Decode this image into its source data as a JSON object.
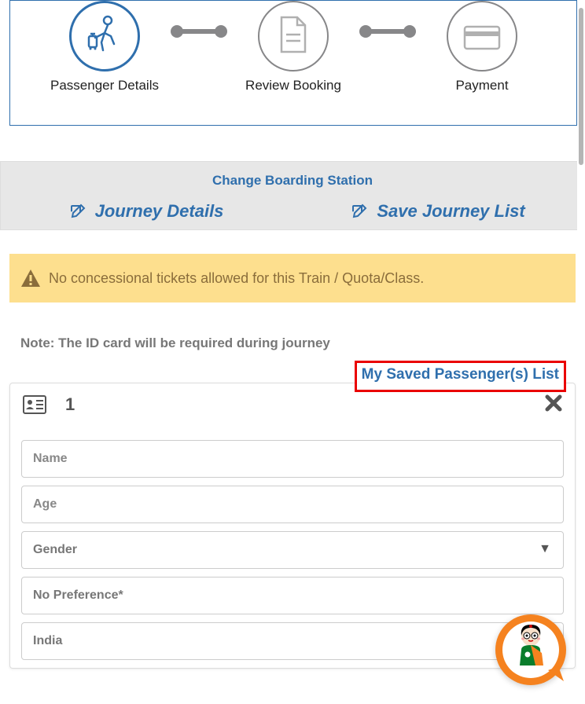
{
  "stepper": {
    "steps": [
      {
        "label": "Passenger Details",
        "icon": "traveler-icon",
        "active": true
      },
      {
        "label": "Review Booking",
        "icon": "document-icon",
        "active": false
      },
      {
        "label": "Payment",
        "icon": "card-icon",
        "active": false
      }
    ]
  },
  "actions": {
    "change_boarding": "Change Boarding Station",
    "journey_details": "Journey Details",
    "save_journey_list": "Save Journey List"
  },
  "warning": {
    "text": "No concessional tickets allowed for this Train / Quota/Class."
  },
  "note": "Note: The ID card will be required during journey",
  "saved_passenger_link": "My Saved Passenger(s) List",
  "passenger": {
    "number": "1",
    "fields": {
      "name_placeholder": "Name",
      "age_placeholder": "Age",
      "gender_placeholder": "Gender",
      "preference_value": "No Preference*",
      "nationality_value": "India"
    }
  },
  "colors": {
    "primary": "#2f6fad",
    "warning_bg": "#fddf8e",
    "warning_text": "#8a6d3b",
    "highlight_border": "#ea0000"
  }
}
